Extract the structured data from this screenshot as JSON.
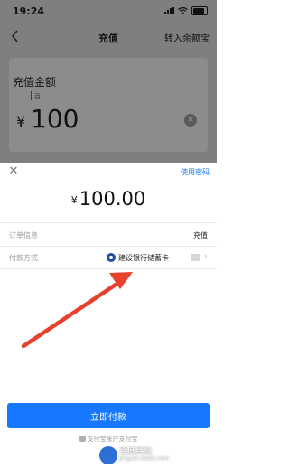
{
  "status_bar": {
    "time": "19:24",
    "icons": [
      "location-arrow-icon",
      "signal-icon",
      "wifi-icon",
      "battery-icon"
    ]
  },
  "nav": {
    "back_icon": "back-chevron-icon",
    "title": "充值",
    "right_action": "转入余额宝"
  },
  "recharge_card": {
    "title": "充值金额",
    "unit_hint": "百",
    "currency": "¥",
    "amount": "100",
    "clear_icon": "clear-icon"
  },
  "sheet": {
    "close_icon": "close-icon",
    "use_password": "使用密码",
    "currency": "¥",
    "amount": "100.00",
    "order": {
      "label": "订单信息",
      "value": "充值"
    },
    "payment": {
      "label": "付款方式",
      "bank": "建设银行储蓄卡",
      "chevron": "›"
    },
    "pay_button": "立即付款",
    "footer": "支付宝账户支付宝"
  },
  "watermark": {
    "text": "百度经验",
    "url": "jingyan.baidu.com"
  },
  "colors": {
    "accent": "#1677ff",
    "annotation_arrow": "#e8412c",
    "overlay": "#7f7f7f"
  }
}
